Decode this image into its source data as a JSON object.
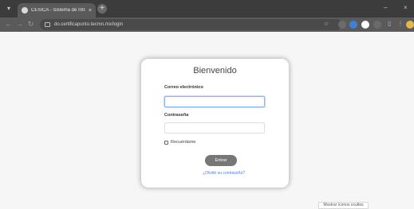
{
  "browser": {
    "tab_title": "CESICA - Sistema de Informac",
    "tab_close": "×",
    "new_tab": "+",
    "url": "do.certificapunto.tecmn.mx/login",
    "minimize": "–",
    "close_window": "×"
  },
  "login": {
    "title": "Bienvenido",
    "email_label": "Correo electrónico",
    "email_value": "",
    "password_label": "Contraseña",
    "password_value": "",
    "remember_label": "Recuérdame",
    "remember_checked": false,
    "submit_label": "Entrar",
    "forgot_link": "¿Olvidó su contraseña?"
  },
  "footer": {
    "show_icons_label": "Mostrar íconos ocultos"
  }
}
